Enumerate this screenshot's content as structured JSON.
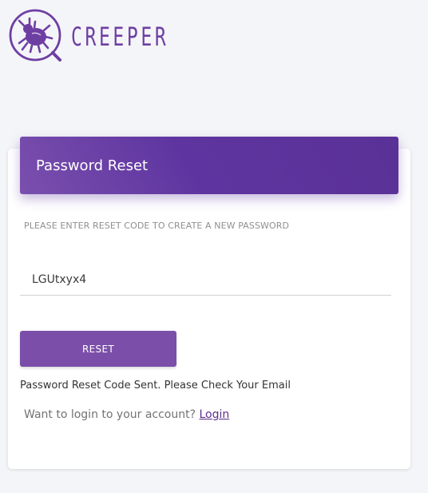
{
  "brand": {
    "name": "CREEPER",
    "logo_icon": "bug-magnifier-icon",
    "color": "#6e3fa3"
  },
  "card": {
    "title": "Password Reset",
    "instruction": "PLEASE ENTER RESET CODE TO CREATE A NEW PASSWORD",
    "code_value": "LGUtxyx4",
    "reset_label": "RESET",
    "status_message": "Password Reset Code Sent. Please Check Your Email",
    "login_prompt": "Want to login to your account?",
    "login_link": "Login"
  },
  "colors": {
    "header_gradient_start": "#7a4fae",
    "header_gradient_end": "#5a3196",
    "button": "#7b4fa9",
    "link": "#5e2d8c",
    "background": "#f4f5f8"
  }
}
